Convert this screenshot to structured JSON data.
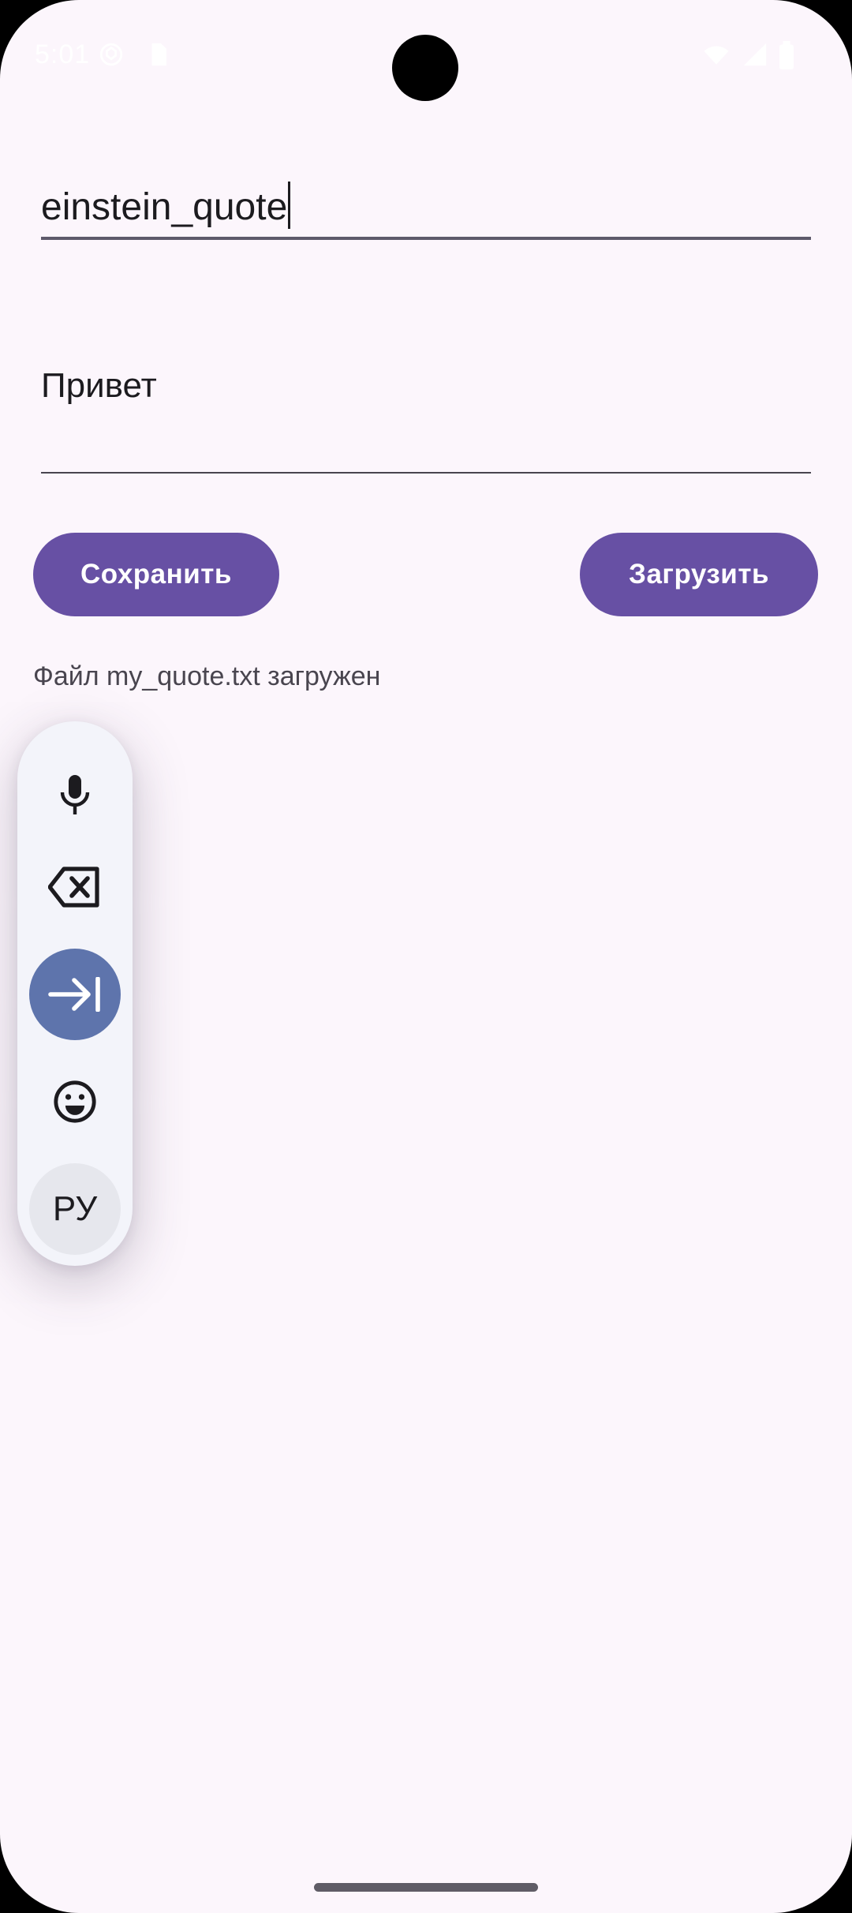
{
  "status_bar": {
    "time": "5:01"
  },
  "filename_field": {
    "value": "einstein_quote"
  },
  "content_field": {
    "value": "Привет"
  },
  "buttons": {
    "save_label": "Сохранить",
    "load_label": "Загрузить"
  },
  "status_message": "Файл my_quote.txt загружен",
  "keyboard_toolbar": {
    "language_label": "РУ",
    "icons": [
      "microphone-icon",
      "backspace-icon",
      "tab-icon",
      "emoji-icon"
    ]
  },
  "colors": {
    "background": "#fcf6fc",
    "primary": "#6750a4",
    "toolbar_accent": "#5e74ac",
    "text": "#1c1b1f"
  }
}
